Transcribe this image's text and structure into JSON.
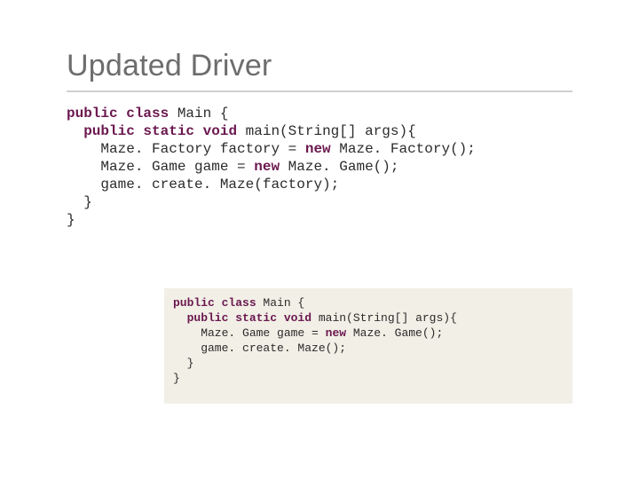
{
  "title": "Updated Driver",
  "code1": {
    "l1a": "public",
    "l1b": " class",
    "l1c": " Main {",
    "l2a": "  public",
    "l2b": " static",
    "l2c": " void",
    "l2d": " main(String[] args){",
    "l3a": "    Maze. Factory factory = ",
    "l3b": "new",
    "l3c": " Maze. Factory();",
    "l4a": "    Maze. Game game = ",
    "l4b": "new",
    "l4c": " Maze. Game();",
    "l5": "    game. create. Maze(factory);",
    "l6": "  }",
    "l7": "}"
  },
  "code2": {
    "l1a": "public",
    "l1b": " class",
    "l1c": " Main {",
    "l2a": "  public",
    "l2b": " static",
    "l2c": " void",
    "l2d": " main(String[] args){",
    "l3a": "    Maze. Game game = ",
    "l3b": "new",
    "l3c": " Maze. Game();",
    "l4": "    game. create. Maze();",
    "l5": "  }",
    "l6": "}"
  }
}
